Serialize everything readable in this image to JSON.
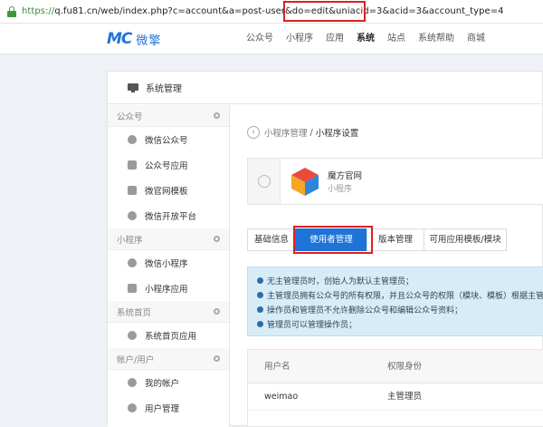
{
  "address_bar": {
    "scheme": "https://",
    "url_rest": "q.fu81.cn/web/index.php?c=account&a=post-user&do=edit&uniacid=3&acid=3&account_type=4"
  },
  "brand": {
    "logo_text": "MC",
    "name": "微擎"
  },
  "top_menu": [
    "公众号",
    "小程序",
    "应用",
    "系统",
    "站点",
    "系统帮助",
    "商城"
  ],
  "active_menu": "系统",
  "panel": {
    "title": "系统管理"
  },
  "sidebar": {
    "sections": [
      {
        "label": "公众号",
        "items": [
          "微信公众号",
          "公众号应用",
          "微官网模板",
          "微信开放平台"
        ]
      },
      {
        "label": "小程序",
        "items": [
          "微信小程序",
          "小程序应用"
        ]
      },
      {
        "label": "系统首页",
        "items": [
          "系统首页应用"
        ]
      },
      {
        "label": "帐户/用户",
        "items": [
          "我的帐户",
          "用户管理"
        ]
      }
    ]
  },
  "breadcrumb": {
    "parent": "小程序管理",
    "separator": "/",
    "current": "小程序设置"
  },
  "app": {
    "name": "魔方官网",
    "type": "小程序"
  },
  "tabs": [
    "基础信息",
    "使用者管理",
    "版本管理",
    "可用应用模板/模块"
  ],
  "active_tab": "使用者管理",
  "notices": [
    "无主管理员时，创始人为默认主管理员；",
    "主管理员拥有公众号的所有权限，并且公众号的权限（模块、模板）根据主管理",
    "操作员和管理员不允许删除公众号和编辑公众号资料；",
    "管理员可以管理操作员；"
  ],
  "table": {
    "headers": [
      "用户名",
      "权限身份"
    ],
    "rows": [
      {
        "username": "weimao",
        "role": "主管理员"
      }
    ]
  },
  "colors": {
    "accent": "#1e74d6",
    "highlight": "#e02020",
    "notice_bg": "#d8ecf8"
  }
}
